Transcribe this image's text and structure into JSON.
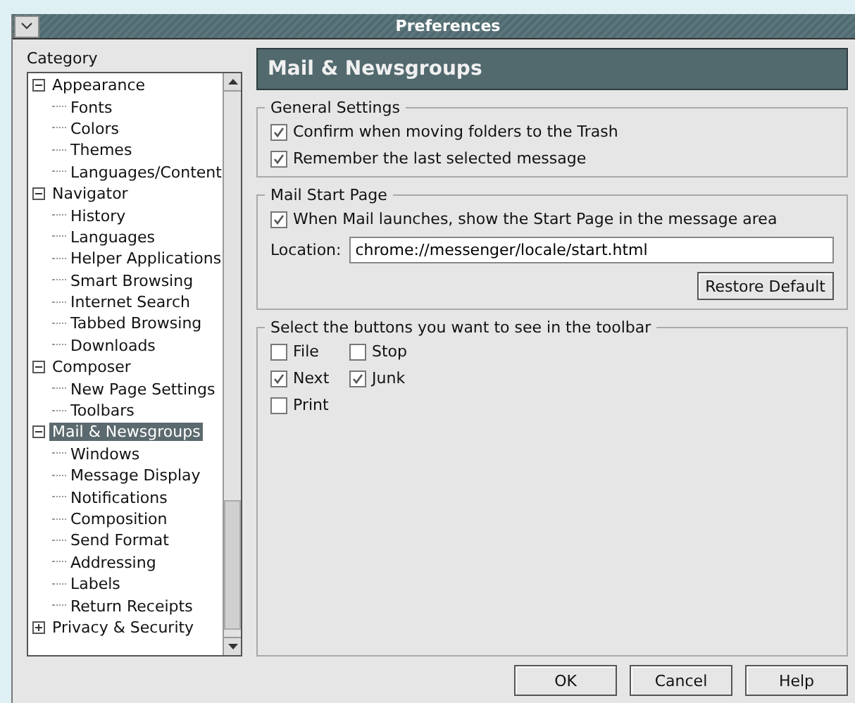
{
  "window": {
    "title": "Preferences"
  },
  "sidebar": {
    "label": "Category",
    "items": [
      {
        "label": "Appearance",
        "expanded": true,
        "selected": false,
        "children": [
          {
            "label": "Fonts",
            "selected": false
          },
          {
            "label": "Colors",
            "selected": false
          },
          {
            "label": "Themes",
            "selected": false
          },
          {
            "label": "Languages/Content",
            "selected": false
          }
        ]
      },
      {
        "label": "Navigator",
        "expanded": true,
        "selected": false,
        "children": [
          {
            "label": "History",
            "selected": false
          },
          {
            "label": "Languages",
            "selected": false
          },
          {
            "label": "Helper Applications",
            "selected": false
          },
          {
            "label": "Smart Browsing",
            "selected": false
          },
          {
            "label": "Internet Search",
            "selected": false
          },
          {
            "label": "Tabbed Browsing",
            "selected": false
          },
          {
            "label": "Downloads",
            "selected": false
          }
        ]
      },
      {
        "label": "Composer",
        "expanded": true,
        "selected": false,
        "children": [
          {
            "label": "New Page Settings",
            "selected": false
          },
          {
            "label": "Toolbars",
            "selected": false
          }
        ]
      },
      {
        "label": "Mail & Newsgroups",
        "expanded": true,
        "selected": true,
        "children": [
          {
            "label": "Windows",
            "selected": false
          },
          {
            "label": "Message Display",
            "selected": false
          },
          {
            "label": "Notifications",
            "selected": false
          },
          {
            "label": "Composition",
            "selected": false
          },
          {
            "label": "Send Format",
            "selected": false
          },
          {
            "label": "Addressing",
            "selected": false
          },
          {
            "label": "Labels",
            "selected": false
          },
          {
            "label": "Return Receipts",
            "selected": false
          }
        ]
      },
      {
        "label": "Privacy & Security",
        "expanded": false,
        "selected": false
      }
    ]
  },
  "panel": {
    "title": "Mail & Newsgroups",
    "general": {
      "title": "General Settings",
      "options": [
        {
          "label": "Confirm when moving folders to the Trash",
          "checked": true
        },
        {
          "label": "Remember the last selected message",
          "checked": true
        }
      ]
    },
    "start_page": {
      "title": "Mail Start Page",
      "option": {
        "label": "When Mail launches, show the Start Page in the message area",
        "checked": true
      },
      "location_label": "Location:",
      "location_value": "chrome://messenger/locale/start.html",
      "restore_button": "Restore Default"
    },
    "toolbar": {
      "title": "Select the buttons you want to see in the toolbar",
      "rows": [
        [
          {
            "label": "File",
            "checked": false
          },
          {
            "label": "Stop",
            "checked": false
          }
        ],
        [
          {
            "label": "Next",
            "checked": true
          },
          {
            "label": "Junk",
            "checked": true
          }
        ],
        [
          {
            "label": "Print",
            "checked": false
          }
        ]
      ]
    }
  },
  "buttons": [
    "OK",
    "Cancel",
    "Help"
  ]
}
